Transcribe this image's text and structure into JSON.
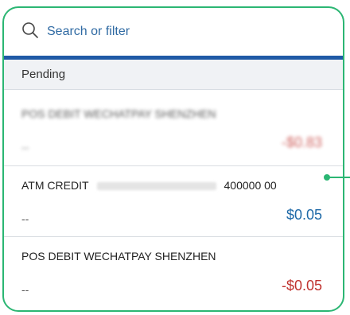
{
  "search": {
    "placeholder": "Search or filter",
    "icon": "search-icon"
  },
  "section": {
    "label": "Pending"
  },
  "transactions": [
    {
      "description": "POS DEBIT WECHATPAY SHENZHEN",
      "detail": "--",
      "amount": "-$0.83",
      "blurred": true,
      "direction": "debit"
    },
    {
      "description": "ATM CREDIT",
      "description_suffix": "400000 00",
      "detail": "--",
      "amount": "$0.05",
      "blurred": false,
      "direction": "credit"
    },
    {
      "description": "POS DEBIT WECHATPAY SHENZHEN",
      "detail": "--",
      "amount": "-$0.05",
      "blurred": false,
      "direction": "debit"
    }
  ],
  "colors": {
    "frame_accent": "#2bb673",
    "header_bar": "#1f5aa6",
    "negative_amount": "#c0332f",
    "positive_amount": "#1f6aa8"
  }
}
